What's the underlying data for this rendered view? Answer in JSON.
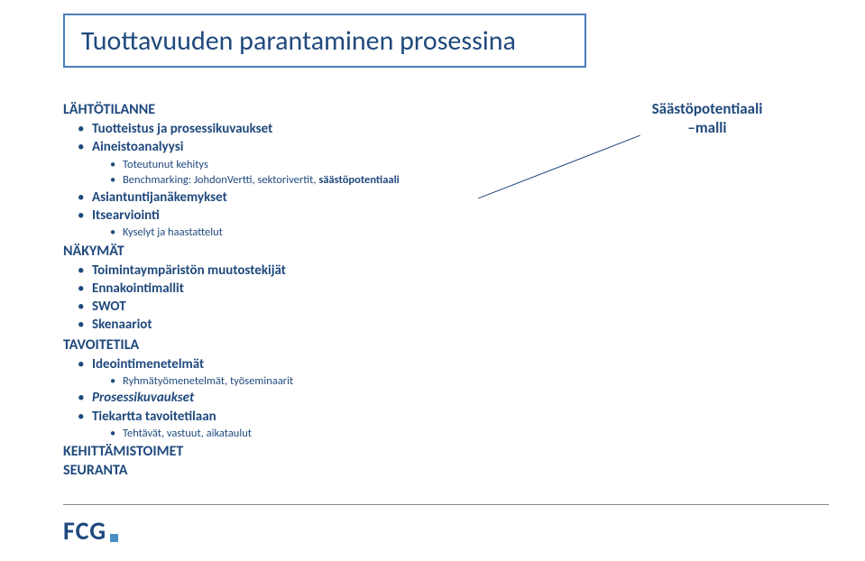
{
  "title": "Tuottavuuden parantaminen prosessina",
  "callout": {
    "line1": "Säästöpotentiaali",
    "line2": "–malli"
  },
  "sections": {
    "s1": {
      "head": "LÄHTÖTILANNE",
      "i1": "Tuotteistus ja prosessikuvaukset",
      "i2": "Aineistoanalyysi",
      "i2a": "Toteutunut kehitys",
      "i2b_pre": "Benchmarking: JohdonVertti, sektorivertit, ",
      "i2b_bold": "säästöpotentiaali",
      "i3": "Asiantuntijanäkemykset",
      "i4": "Itsearviointi",
      "i4a": "Kyselyt ja haastattelut"
    },
    "s2": {
      "head": "NÄKYMÄT",
      "i1": "Toimintaympäristön muutostekijät",
      "i2": "Ennakointimallit",
      "i3": "SWOT",
      "i4": "Skenaariot"
    },
    "s3": {
      "head": "TAVOITETILA",
      "i1": "Ideointimenetelmät",
      "i1a": "Ryhmätyömenetelmät, työseminaarit",
      "i2": "Prosessikuvaukset",
      "i3": "Tiekartta tavoitetilaan",
      "i3a": "Tehtävät, vastuut, aikataulut"
    },
    "s4": {
      "head": "KEHITTÄMISTOIMET"
    },
    "s5": {
      "head": "SEURANTA"
    }
  },
  "logo": "FCG"
}
